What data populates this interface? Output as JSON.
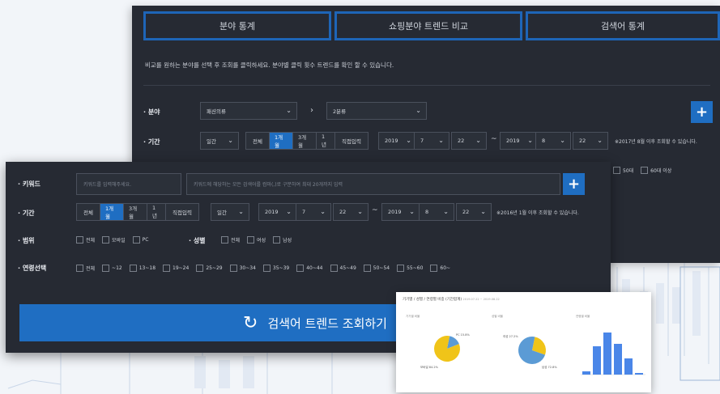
{
  "tabs": [
    "분야 통계",
    "쇼핑분야 트렌드 비교",
    "검색어 통계"
  ],
  "back": {
    "description": "비교를 원하는 분야를 선택 후 조회를 클릭하세요. 분야별 클릭 횟수 트렌드를 확인 할 수 있습니다.",
    "field_label": "· 분야",
    "category1": "패션의류",
    "category2": "2분류",
    "period_label": "· 기간",
    "unit": "일간",
    "period_options": [
      "전체",
      "1개월",
      "3개월",
      "1년",
      "직접입력"
    ],
    "period_selected": "1개월",
    "from": {
      "year": "2019",
      "month": "7",
      "day": "22"
    },
    "to": {
      "year": "2019",
      "month": "8",
      "day": "22"
    },
    "tilde": "~",
    "note": "※2017년 8월 이후 조회할 수 있습니다.",
    "age_partial": [
      "50대",
      "60대 이상"
    ]
  },
  "front": {
    "keyword_label": "· 키워드",
    "keyword_placeholder": "키워드를 입력해주세요.",
    "keyword_detail_placeholder": "키워드에 해당하는 모든 검색어를 컴마(,)로 구분하여 최대 20개까지 입력",
    "period_label": "· 기간",
    "period_options": [
      "전체",
      "1개월",
      "3개월",
      "1년",
      "직접입력"
    ],
    "period_selected": "1개월",
    "unit": "일간",
    "from": {
      "year": "2019",
      "month": "7",
      "day": "22"
    },
    "to": {
      "year": "2019",
      "month": "8",
      "day": "22"
    },
    "tilde": "~",
    "note": "※2016년 1월 이후 조회할 수 있습니다.",
    "range_label": "· 범위",
    "range_options": [
      "전체",
      "모바일",
      "PC"
    ],
    "gender_label": "· 성별",
    "gender_options": [
      "전체",
      "여성",
      "남성"
    ],
    "age_label": "· 연령선택",
    "age_options": [
      "전체",
      "~12",
      "13~18",
      "19~24",
      "25~29",
      "30~34",
      "35~39",
      "40~44",
      "45~49",
      "50~54",
      "55~60",
      "60~"
    ],
    "search_button": "검색어 트렌드 조회하기"
  },
  "report": {
    "title": "기기별 / 성별 / 연령별 비중 (기간합계)",
    "date_range": "2019.07.22 ~ 2019.08.22",
    "sections": [
      "기기별 비율",
      "성별 비율",
      "연령별 비율"
    ],
    "device_pie": {
      "labels": [
        "PC 15.8%",
        "모바일 84.2%"
      ],
      "values": [
        15.8,
        84.2
      ]
    },
    "gender_pie": {
      "labels": [
        "여성 27.2%",
        "남성 72.8%"
      ],
      "values": [
        27.2,
        72.8
      ]
    },
    "age_bars": [
      4,
      35,
      52,
      38,
      20,
      2
    ],
    "colors": {
      "pie_a": "#5b9bd5",
      "pie_b": "#f0c419",
      "bar": "#4a86e8"
    }
  }
}
